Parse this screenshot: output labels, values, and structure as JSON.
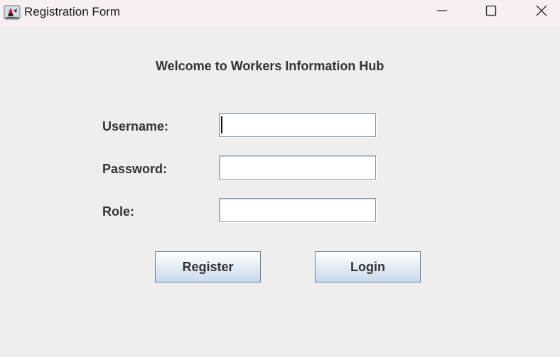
{
  "window": {
    "title": "Registration Form",
    "icon": "java-duke-icon"
  },
  "controls": {
    "minimize": "minimize-icon",
    "maximize": "maximize-icon",
    "close": "close-icon"
  },
  "form": {
    "heading": "Welcome to Workers Information Hub",
    "username": {
      "label": "Username:",
      "value": ""
    },
    "password": {
      "label": "Password:",
      "value": ""
    },
    "role": {
      "label": "Role:",
      "value": ""
    }
  },
  "buttons": {
    "register": "Register",
    "login": "Login"
  },
  "colors": {
    "background": "#eeeeee",
    "titlebar": "#f7eff2",
    "button_gradient_top": "#ffffff",
    "button_gradient_bottom": "#c9d9ea",
    "button_border": "#6d8197"
  }
}
